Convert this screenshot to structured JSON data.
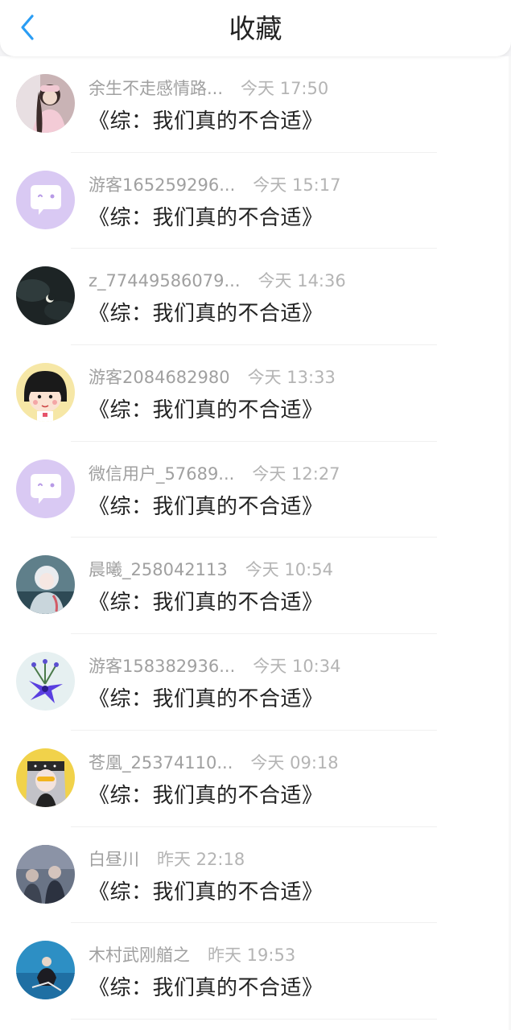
{
  "header": {
    "title": "收藏",
    "back_icon": "chevron-left-icon",
    "accent": "#2a9df4"
  },
  "items": [
    {
      "name": "余生不走感情路...",
      "time": "今天 17:50",
      "book": "《综：我们真的不合适》",
      "avatar": "photo-girl-pink"
    },
    {
      "name": "游客165259296...",
      "time": "今天 15:17",
      "book": "《综：我们真的不合适》",
      "avatar": "default-chat-bubble"
    },
    {
      "name": "z_77449586079...",
      "time": "今天 14:36",
      "book": "《综：我们真的不合适》",
      "avatar": "dark-moon"
    },
    {
      "name": "游客2084682980",
      "time": "今天 13:33",
      "book": "《综：我们真的不合适》",
      "avatar": "cartoon-girl-bob"
    },
    {
      "name": "微信用户_57689...",
      "time": "今天 12:27",
      "book": "《综：我们真的不合适》",
      "avatar": "default-chat-bubble"
    },
    {
      "name": "晨曦_258042113",
      "time": "今天 10:54",
      "book": "《综：我们真的不合适》",
      "avatar": "anime-white-hair"
    },
    {
      "name": "游客158382936...",
      "time": "今天 10:34",
      "book": "《综：我们真的不合适》",
      "avatar": "purple-flowers"
    },
    {
      "name": "苍凰_25374110...",
      "time": "今天 09:18",
      "book": "《综：我们真的不合适》",
      "avatar": "anime-bandana"
    },
    {
      "name": "白昼川",
      "time": "昨天 22:18",
      "book": "《综：我们真的不合适》",
      "avatar": "photo-dim-figures"
    },
    {
      "name": "木村武刚艏之",
      "time": "昨天 19:53",
      "book": "《综：我们真的不合适》",
      "avatar": "photo-blue-sea"
    }
  ]
}
